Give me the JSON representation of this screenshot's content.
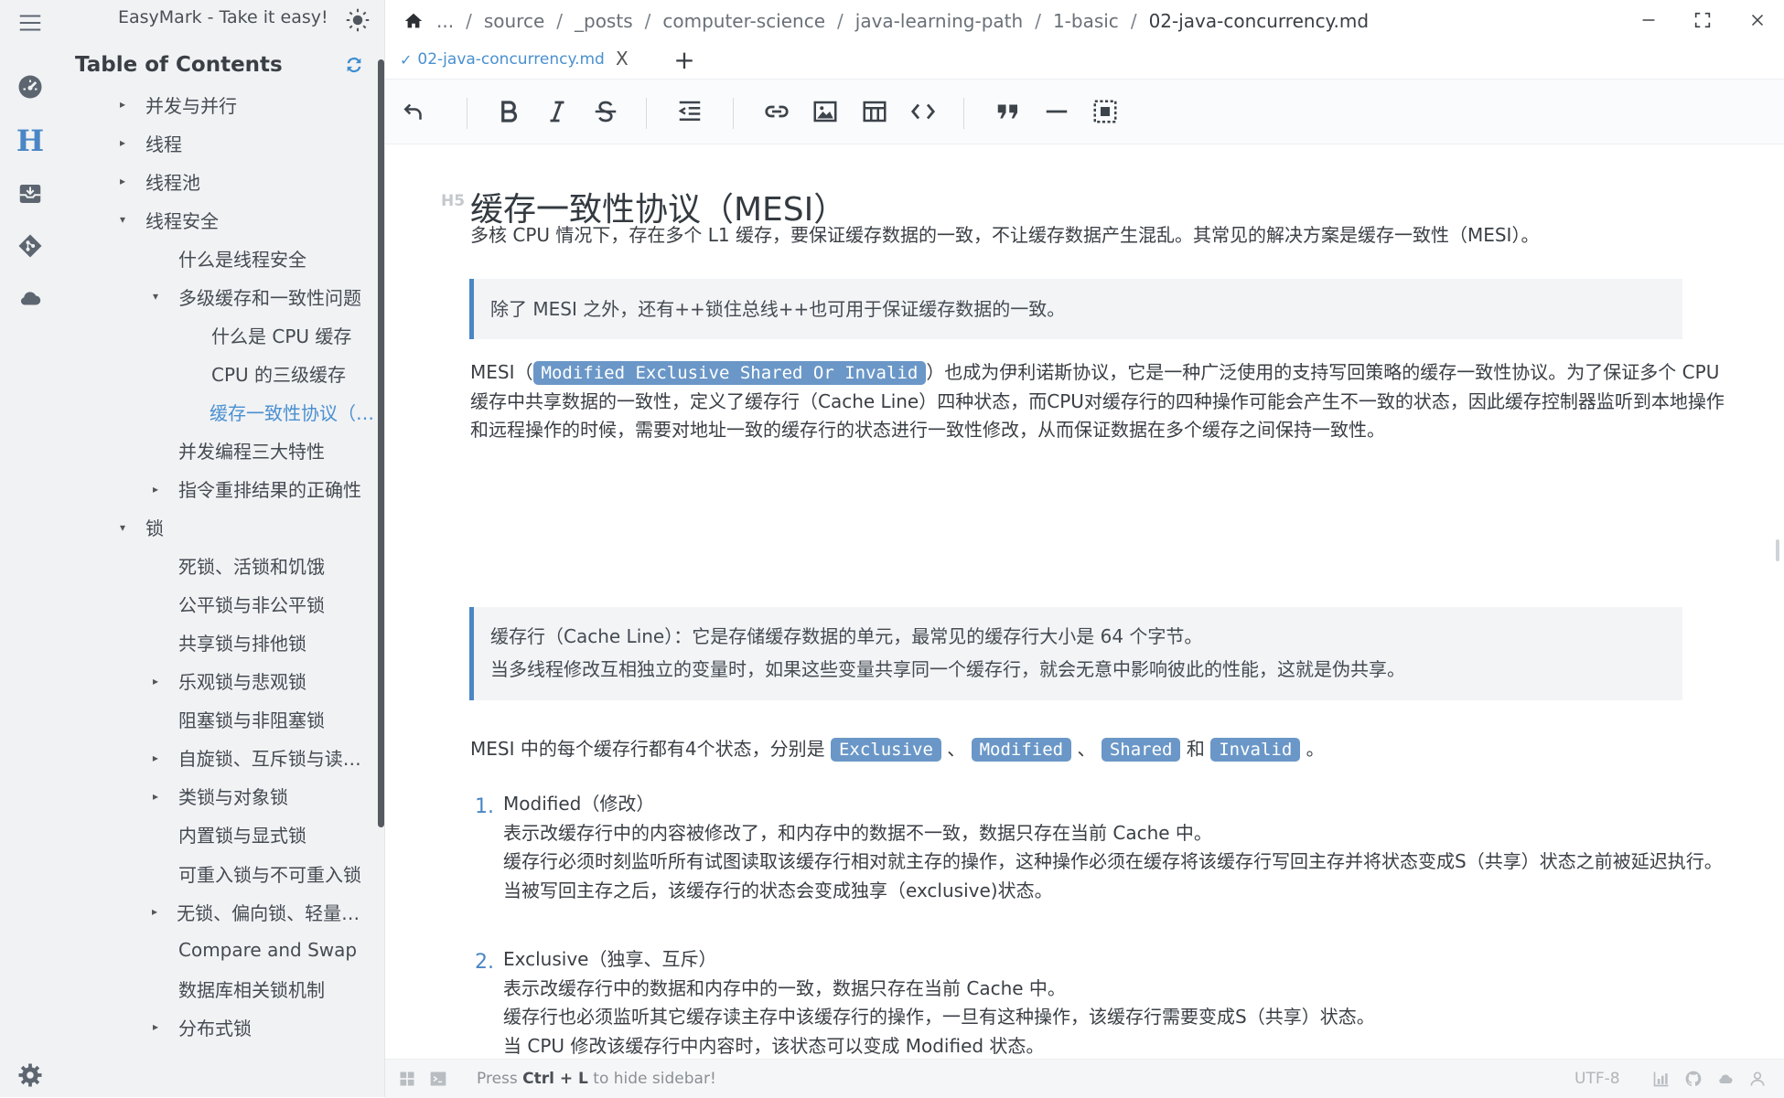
{
  "app": {
    "title": "EasyMark - Take it easy!"
  },
  "toc": {
    "title": "Table of Contents",
    "items": [
      {
        "label": "并发与并行",
        "caret": "▸"
      },
      {
        "label": "线程",
        "caret": "▸"
      },
      {
        "label": "线程池",
        "caret": "▸"
      },
      {
        "label": "线程安全",
        "caret": "▾"
      },
      {
        "label": "什么是线程安全",
        "caret": ""
      },
      {
        "label": "多级缓存和一致性问题",
        "caret": "▾"
      },
      {
        "label": "什么是 CPU 缓存",
        "caret": ""
      },
      {
        "label": "CPU 的三级缓存",
        "caret": ""
      },
      {
        "label": "缓存一致性协议（MES...",
        "caret": ""
      },
      {
        "label": "并发编程三大特性",
        "caret": ""
      },
      {
        "label": "指令重排结果的正确性",
        "caret": "▸"
      },
      {
        "label": "锁",
        "caret": "▾"
      },
      {
        "label": "死锁、活锁和饥饿",
        "caret": ""
      },
      {
        "label": "公平锁与非公平锁",
        "caret": ""
      },
      {
        "label": "共享锁与排他锁",
        "caret": ""
      },
      {
        "label": "乐观锁与悲观锁",
        "caret": "▸"
      },
      {
        "label": "阻塞锁与非阻塞锁",
        "caret": ""
      },
      {
        "label": "自旋锁、互斥锁与读写锁",
        "caret": "▸"
      },
      {
        "label": "类锁与对象锁",
        "caret": "▸"
      },
      {
        "label": "内置锁与显式锁",
        "caret": ""
      },
      {
        "label": "可重入锁与不可重入锁",
        "caret": ""
      },
      {
        "label": "无锁、偏向锁、轻量级锁...",
        "caret": "▸"
      },
      {
        "label": "Compare and Swap",
        "caret": ""
      },
      {
        "label": "数据库相关锁机制",
        "caret": ""
      },
      {
        "label": "分布式锁",
        "caret": "▸"
      }
    ]
  },
  "breadcrumb": [
    "...",
    "source",
    "_posts",
    "computer-science",
    "java-learning-path",
    "1-basic",
    "02-java-concurrency.md"
  ],
  "tab": {
    "check": "✓",
    "name": "02-java-concurrency.md",
    "close": "X",
    "add": "+"
  },
  "doc": {
    "heading_level": "H5",
    "heading": "缓存一致性协议（MESI）",
    "p1": "多核 CPU 情况下，存在多个 L1 缓存，要保证缓存数据的一致，不让缓存数据产生混乱。其常见的解决方案是缓存一致性（MESI）。",
    "quote1": "除了 MESI 之外，还有++锁住总线++也可用于保证缓存数据的一致。",
    "p2_pre": "MESI（",
    "p2_code": "Modified Exclusive Shared Or Invalid",
    "p2_post": "）也成为伊利诺斯协议，它是一种广泛使用的支持写回策略的缓存一致性协议。为了保证多个 CPU 缓存中共享数据的一致性，定义了缓存行（Cache Line）四种状态，而CPU对缓存行的四种操作可能会产生不一致的状态，因此缓存控制器监听到本地操作和远程操作的时候，需要对地址一致的缓存行的状态进行一致性修改，从而保证数据在多个缓存之间保持一致性。",
    "quote2_l1": "缓存行（Cache Line）：它是存储缓存数据的单元，最常见的缓存行大小是 64 个字节。",
    "quote2_l2": "当多线程修改互相独立的变量时，如果这些变量共享同一个缓存行，就会无意中影响彼此的性能，这就是伪共享。",
    "p3_pre": "MESI 中的每个缓存行都有4个状态，分别是 ",
    "p3_c1": "Exclusive",
    "p3_s1": " 、 ",
    "p3_c2": "Modified",
    "p3_s2": " 、 ",
    "p3_c3": "Shared",
    "p3_s3": " 和 ",
    "p3_c4": "Invalid",
    "p3_end": " 。",
    "li1_num": "1.",
    "li1_title": "Modified（修改）",
    "li1_l1": "表示改缓存行中的内容被修改了，和内存中的数据不一致，数据只存在当前 Cache 中。",
    "li1_l2": "缓存行必须时刻监听所有试图读取该缓存行相对就主存的操作，这种操作必须在缓存将该缓存行写回主存并将状态变成S（共享）状态之前被延迟执行。",
    "li1_l3": "当被写回主存之后，该缓存行的状态会变成独享（exclusive)状态。",
    "li2_num": "2.",
    "li2_title": "Exclusive（独享、互斥）",
    "li2_l1": "表示改缓存行中的数据和内存中的一致，数据只存在当前 Cache 中。",
    "li2_l2": "缓存行也必须监听其它缓存读主存中该缓存行的操作，一旦有这种操作，该缓存行需要变成S（共享）状态。",
    "li2_l3": "当 CPU 修改该缓存行中内容时，该状态可以变成 Modified 状态。"
  },
  "status": {
    "hint_pre": "Press ",
    "hint_key": "Ctrl + L",
    "hint_post": " to hide sidebar!",
    "encoding": "UTF-8"
  },
  "colors": {
    "accent": "#4a90d0",
    "chip": "#6a97c7",
    "quote_border": "#4a86c5"
  },
  "icons": [
    "menu-icon",
    "sun-icon",
    "dashboard-icon",
    "heading-icon",
    "inbox-icon",
    "git-icon",
    "cloud-icon",
    "settings-icon",
    "refresh-icon",
    "home-icon",
    "undo-icon",
    "bold-icon",
    "italic-icon",
    "strikethrough-icon",
    "outdent-icon",
    "link-icon",
    "image-icon",
    "table-icon",
    "code-icon",
    "quote-icon",
    "horizontal-rule-icon",
    "select-all-icon"
  ]
}
